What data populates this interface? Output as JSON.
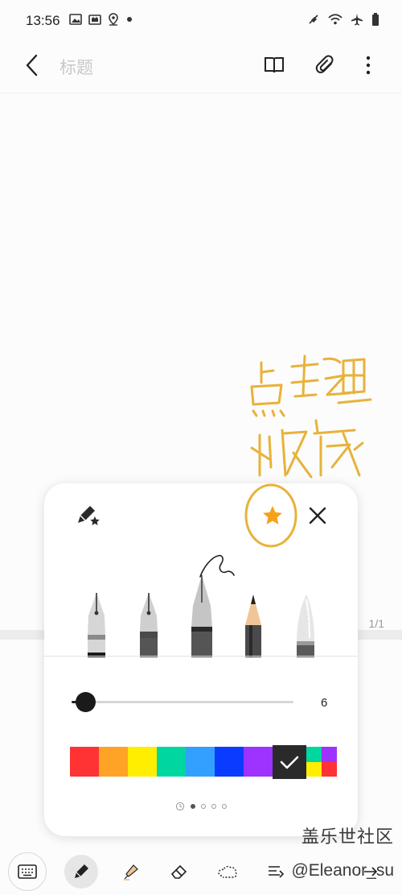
{
  "status_bar": {
    "time": "13:56",
    "left_icons": [
      "gallery-icon",
      "screenshot-icon",
      "location-icon",
      "dot-icon"
    ],
    "right_icons": [
      "mute-icon",
      "wifi-icon",
      "airplane-icon",
      "battery-icon"
    ]
  },
  "appbar": {
    "title_placeholder": "标题",
    "actions": [
      "book-icon",
      "attachment-icon",
      "more-icon"
    ]
  },
  "page_indicator": "1/1",
  "handwriting": {
    "text": "点这里收藏",
    "color": "#e8b23a"
  },
  "pen_settings": {
    "pen_types": [
      "fountain-pen",
      "calligraphy-pen",
      "brush-pen",
      "pencil",
      "marker"
    ],
    "selected_pen": "brush-pen",
    "size_value": "6",
    "size_fraction": 0.06,
    "colors": [
      "#ff3333",
      "#ffa326",
      "#ffee00",
      "#00d6a0",
      "#33a0ff",
      "#0a3cff",
      "#9e33ff"
    ],
    "selected_color": "#2a2a2a",
    "multi_color": [
      "#00d6a0",
      "#9e33ff",
      "#ffee00",
      "#ff3333"
    ],
    "page_dots": 4,
    "active_dot": 0
  },
  "watermark": {
    "site": "盖乐世社区",
    "user": "@Eleanor_su"
  },
  "bottom_tools": [
    "keyboard-icon",
    "pen-icon",
    "highlighter-icon",
    "eraser-icon",
    "lasso-icon",
    "text-format-icon",
    "more-tools-icon"
  ]
}
